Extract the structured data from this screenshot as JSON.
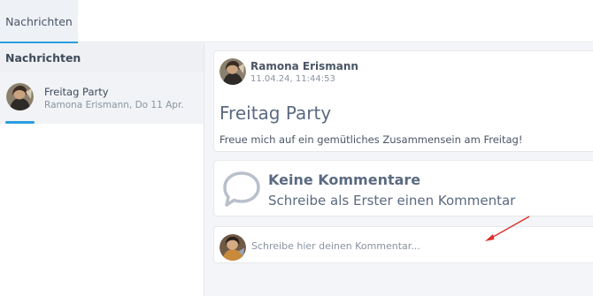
{
  "tabs": [
    {
      "label": "Nachrichten",
      "active": true
    }
  ],
  "sidebar": {
    "header": "Nachrichten",
    "conversations": [
      {
        "title": "Freitag Party",
        "subtitle": "Ramona Erismann, Do 11 Apr."
      }
    ]
  },
  "post": {
    "author": "Ramona Erismann",
    "date": "11.04.24, 11:44:53",
    "title": "Freitag Party",
    "body": "Freue mich auf ein gemütliches Zusammensein am Freitag!"
  },
  "comments": {
    "empty_title": "Keine Kommentare",
    "empty_subtitle": "Schreibe als Erster einen Kommentar",
    "input_placeholder": "Schreibe hier deinen Kommentar..."
  },
  "colors": {
    "accent": "#2a9de0",
    "annotation_arrow": "#d9302a"
  },
  "icons": [
    "speech-bubble-icon",
    "avatar",
    "annotation-arrow"
  ]
}
